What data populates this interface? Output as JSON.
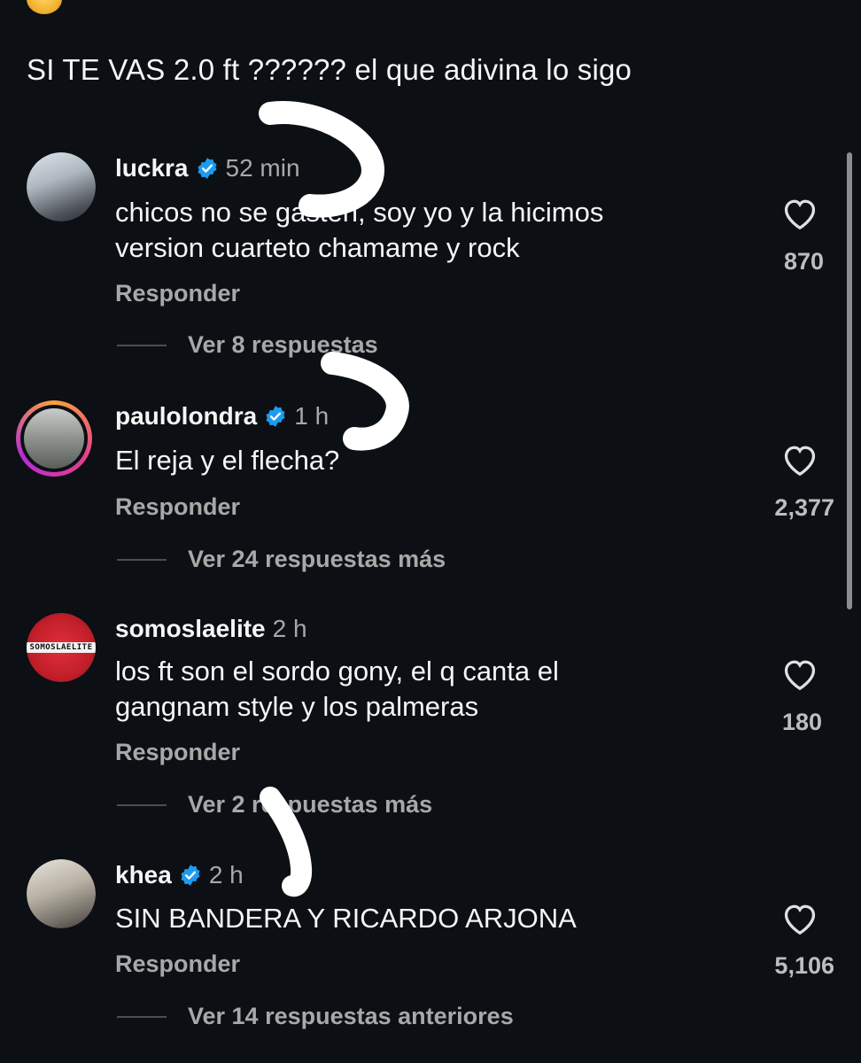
{
  "post": {
    "caption": "SI TE VAS 2.0 ft ?????? el que adivina lo sigo"
  },
  "reply_label": "Responder",
  "comments": [
    {
      "username": "luckra",
      "verified": true,
      "time": "52 min",
      "text": "chicos no se gasten, soy yo y la hicimos\nversion cuarteto chamame y rock",
      "likes": "870",
      "view_replies": "Ver 8 respuestas"
    },
    {
      "username": "paulolondra",
      "verified": true,
      "time": "1 h",
      "text": "El reja y el flecha?",
      "likes": "2,377",
      "view_replies": "Ver 24 respuestas más"
    },
    {
      "username": "somoslaelite",
      "verified": false,
      "avatar_text": "SOMOSLAELITE",
      "time": "2 h",
      "text": "los ft son el sordo gony, el q canta el\ngangnam style y los palmeras",
      "likes": "180",
      "view_replies": "Ver 2 respuestas más"
    },
    {
      "username": "khea",
      "verified": true,
      "time": "2 h",
      "text": "SIN BANDERA Y RICARDO ARJONA",
      "likes": "5,106",
      "view_replies": "Ver 14 respuestas anteriores"
    }
  ],
  "colors": {
    "background": "#0c0f14",
    "text": "#f5f5f5",
    "secondary": "#a8a8a8",
    "verified": "#1d9bf0",
    "annotation": "#ffffff"
  }
}
